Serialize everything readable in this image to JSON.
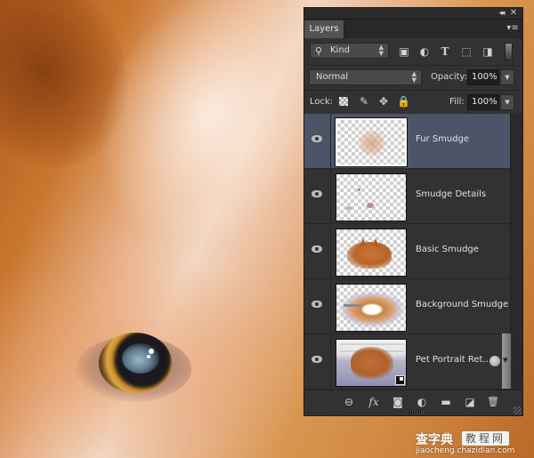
{
  "panel": {
    "title": "Layers",
    "collapse_glyph": "◂◂",
    "close_glyph": "✕",
    "menu_glyph": "▾≡"
  },
  "filter": {
    "kind_label": "Kind",
    "icons": [
      "image-filter-icon",
      "adjustment-filter-icon",
      "type-filter-icon",
      "shape-filter-icon",
      "smart-object-filter-icon"
    ]
  },
  "blend": {
    "mode": "Normal",
    "opacity_label": "Opacity:",
    "opacity_value": "100%",
    "fill_label": "Fill:",
    "fill_value": "100%",
    "lock_label": "Lock:"
  },
  "layers": [
    {
      "name": "Fur Smudge",
      "visible": true,
      "selected": true
    },
    {
      "name": "Smudge Details",
      "visible": true,
      "selected": false
    },
    {
      "name": "Basic Smudge",
      "visible": true,
      "selected": false
    },
    {
      "name": "Background Smudge",
      "visible": true,
      "selected": false
    },
    {
      "name": "Pet Portrait Ret...",
      "visible": true,
      "selected": false,
      "smart_object": true,
      "linked": true
    }
  ],
  "footer": {
    "link_glyph": "⊖",
    "fx_label": "fx",
    "mask_glyph": "◙",
    "adjust_glyph": "◐",
    "folder_glyph": "▬",
    "new_glyph": "◪",
    "trash_glyph": "🗑"
  },
  "watermark": {
    "brand": "查字典",
    "box": "教程网",
    "url": "jiaocheng.chazidian.com"
  },
  "colors": {
    "panel_bg": "#323232",
    "selected_row": "#4c5468",
    "fur_orange": "#cf8540"
  }
}
